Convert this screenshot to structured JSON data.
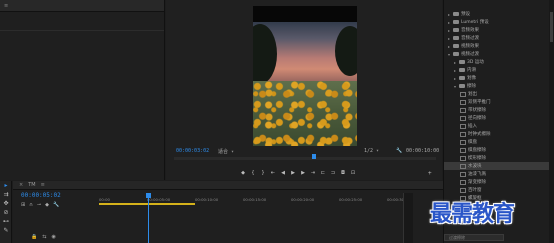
{
  "monitor": {
    "current_tc": "00:00:03:02",
    "zoom_label": "适合",
    "quality_label": "1/2",
    "duration_tc": "00:00:10:00"
  },
  "transport_icons": [
    "marker-icon",
    "in-point-icon",
    "out-point-icon",
    "go-to-in-icon",
    "step-back-icon",
    "play-icon",
    "step-forward-icon",
    "go-to-out-icon",
    "insert-icon",
    "overwrite-icon",
    "export-frame-icon",
    "button-editor-icon",
    "add-icon"
  ],
  "effects": {
    "items": [
      {
        "label": "预设",
        "kind": "folder",
        "indent": 0,
        "open": false
      },
      {
        "label": "Lumetri 预设",
        "kind": "folder",
        "indent": 0,
        "open": false
      },
      {
        "label": "音频效果",
        "kind": "folder",
        "indent": 0,
        "open": false
      },
      {
        "label": "音频过渡",
        "kind": "folder",
        "indent": 0,
        "open": false
      },
      {
        "label": "视频效果",
        "kind": "folder",
        "indent": 0,
        "open": false
      },
      {
        "label": "视频过渡",
        "kind": "folder",
        "indent": 0,
        "open": true
      },
      {
        "label": "3D 运动",
        "kind": "folder",
        "indent": 1,
        "open": false
      },
      {
        "label": "内滑",
        "kind": "folder",
        "indent": 1,
        "open": false
      },
      {
        "label": "划像",
        "kind": "folder",
        "indent": 1,
        "open": false
      },
      {
        "label": "擦除",
        "kind": "folder",
        "indent": 1,
        "open": true
      },
      {
        "label": "划出",
        "kind": "fx",
        "indent": 2
      },
      {
        "label": "双侧平推门",
        "kind": "fx",
        "indent": 2
      },
      {
        "label": "带状擦除",
        "kind": "fx",
        "indent": 2
      },
      {
        "label": "径向擦除",
        "kind": "fx",
        "indent": 2
      },
      {
        "label": "插入",
        "kind": "fx",
        "indent": 2
      },
      {
        "label": "时钟式擦除",
        "kind": "fx",
        "indent": 2
      },
      {
        "label": "棋盘",
        "kind": "fx",
        "indent": 2
      },
      {
        "label": "棋盘擦除",
        "kind": "fx",
        "indent": 2
      },
      {
        "label": "楔形擦除",
        "kind": "fx",
        "indent": 2
      },
      {
        "label": "水波块",
        "kind": "fx",
        "indent": 2,
        "selected": true
      },
      {
        "label": "油漆飞溅",
        "kind": "fx",
        "indent": 2
      },
      {
        "label": "渐变擦除",
        "kind": "fx",
        "indent": 2
      },
      {
        "label": "百叶窗",
        "kind": "fx",
        "indent": 2
      },
      {
        "label": "螺旋框",
        "kind": "fx",
        "indent": 2
      },
      {
        "label": "随机块",
        "kind": "fx",
        "indent": 2
      },
      {
        "label": "随机擦除",
        "kind": "fx",
        "indent": 2
      },
      {
        "label": "风车",
        "kind": "fx",
        "indent": 2
      }
    ],
    "search_placeholder": "过渡擦除"
  },
  "timeline": {
    "sequence_tab": "TM",
    "current_tc": "00:00:05:02",
    "ruler_ticks": [
      "00:00",
      "00:00:05:00",
      "00:00:10:00",
      "00:00:15:00",
      "00:00:20:00",
      "00:00:25:00",
      "00:00:30:00"
    ]
  },
  "watermark_text": "最需教育",
  "colors": {
    "accent": "#2d8ceb",
    "work_area": "#d5b21b",
    "watermark": "#2a56c8"
  }
}
